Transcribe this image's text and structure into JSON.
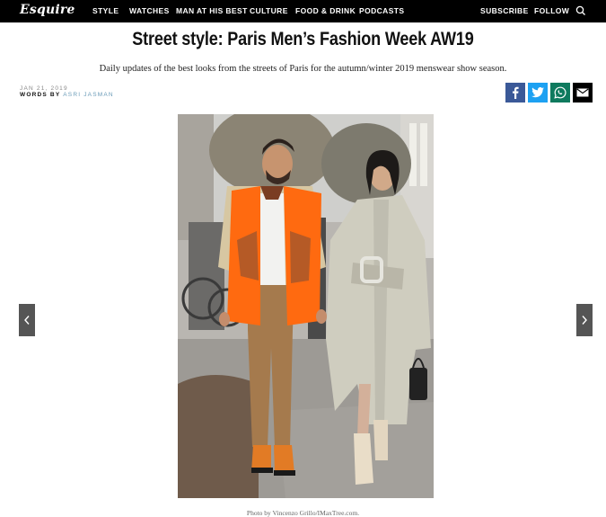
{
  "nav": {
    "logo": "Esquire",
    "items": [
      "STYLE",
      "WATCHES",
      "MAN AT HIS BEST",
      "CULTURE",
      "FOOD & DRINK",
      "PODCASTS"
    ],
    "subscribe": "SUBSCRIBE",
    "follow": "FOLLOW",
    "search_icon": "search-icon"
  },
  "article": {
    "title": "Street style: Paris Men’s Fashion Week AW19",
    "dek": "Daily updates of the best looks from the streets of Paris for the autumn/winter 2019 menswear show season.",
    "date": "JAN 21, 2019",
    "words_by_label": "WORDS BY",
    "author": "ASRI JASMAN"
  },
  "share": [
    {
      "icon": "facebook-icon",
      "color": "#3b5998"
    },
    {
      "icon": "twitter-icon",
      "color": "#1da1f2"
    },
    {
      "icon": "whatsapp-icon",
      "color": "#0f7a5e"
    },
    {
      "icon": "email-icon",
      "color": "#000000"
    }
  ],
  "gallery": {
    "caption": "Photo by Vincenzo Grillo/IMaxTree.com.",
    "prev_icon": "chevron-left-icon",
    "next_icon": "chevron-right-icon"
  }
}
